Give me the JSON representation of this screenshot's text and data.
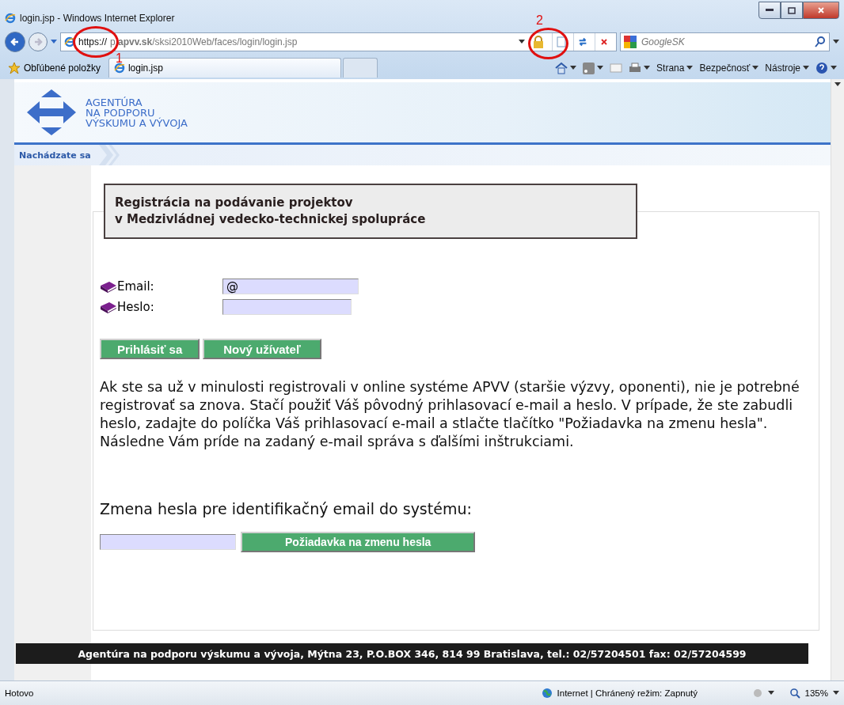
{
  "window": {
    "title": "login.jsp - Windows Internet Explorer"
  },
  "address_bar": {
    "scheme": "https://",
    "url": "p.**apvv.sk**/sksi2010Web/faces/login/login.jsp"
  },
  "search": {
    "placeholder": "GoogleSK"
  },
  "favorites": {
    "label": "Obľúbené položky"
  },
  "tabs": [
    {
      "label": "login.jsp",
      "selected": true
    }
  ],
  "command_bar": [
    "Strana",
    "Bezpečnosť",
    "Nástroje"
  ],
  "annotations": [
    {
      "label": "1"
    },
    {
      "label": "2"
    }
  ],
  "page": {
    "logo_lines": [
      "AGENTÚRA",
      "NA PODPORU",
      "VÝSKUMU A VÝVOJA"
    ],
    "breadcrumb": "Nachádzate sa",
    "heading_lines": [
      "Registrácia na podávanie projektov",
      "v Medzivládnej vedecko-technickej spolupráce"
    ],
    "fields": [
      {
        "label": "Email:",
        "value": "@"
      },
      {
        "label": "Heslo:"
      }
    ],
    "buttons": [
      "Prihlásiť sa",
      "Nový užívateľ"
    ],
    "info": "Ak ste sa už v minulosti registrovali v online systéme APVV (staršie výzvy, oponenti), nie je potrebné registrovať sa znova. Stačí použiť Váš pôvodný prihlasovací e-mail a heslo. V prípade, že ste zabudli heslo, zadajte do políčka Váš prihlasovací e-mail a stlačte tlačítko \"Požiadavka na zmenu hesla\". Následne Vám príde na zadaný e-mail správa s ďalšími inštrukciami.",
    "reset_title": "Zmena hesla pre identifikačný email do systému:",
    "reset_button": "Požiadavka na zmenu hesla",
    "footer": "Agentúra na podporu výskumu a vývoja, Mýtna 23, P.O.BOX 346, 814 99 Bratislava, tel.: 02/57204501 fax: 02/57204599"
  },
  "status_bar": {
    "text": "Hotovo",
    "zone": "Internet | Chránený režim: Zapnutý",
    "zoom": "135%"
  }
}
